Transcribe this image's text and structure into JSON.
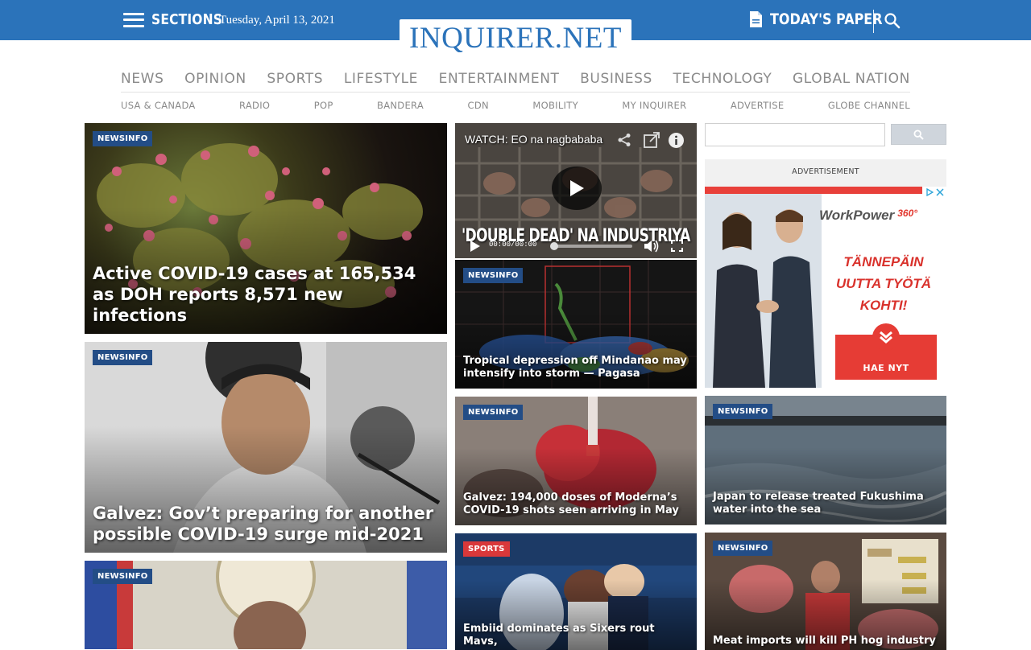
{
  "header": {
    "sections_label": "SECTIONS",
    "date": "Tuesday, April 13, 2021",
    "logo": "INQUIRER.NET",
    "todays_paper_label": "TODAY'S PAPER",
    "brand_color": "#2b73ba"
  },
  "main_nav": [
    "NEWS",
    "OPINION",
    "SPORTS",
    "LIFESTYLE",
    "ENTERTAINMENT",
    "BUSINESS",
    "TECHNOLOGY",
    "GLOBAL NATION"
  ],
  "sub_nav": [
    "USA & CANADA",
    "RADIO",
    "POP",
    "BANDERA",
    "CDN",
    "MOBILITY",
    "MY INQUIRER",
    "ADVERTISE",
    "GLOBE CHANNEL"
  ],
  "stories": [
    {
      "category": "NEWSINFO",
      "headline": "Active COVID-19 cases at 165,534 as DOH reports 8,571 new infections"
    },
    {
      "category": "NEWSINFO",
      "headline": "Galvez: Gov’t preparing for another possible COVID-19 surge mid-2021"
    },
    {
      "category": "NEWSINFO",
      "headline": ""
    },
    {
      "category": "NEWSINFO",
      "headline": "Tropical depression off Mindanao may intensify into storm — Pagasa"
    },
    {
      "category": "NEWSINFO",
      "headline": "Galvez: 194,000 doses of Moderna’s COVID-19 shots seen arriving in May"
    },
    {
      "category": "SPORTS",
      "headline": "Embiid dominates as Sixers rout Mavs,"
    },
    {
      "category": "NEWSINFO",
      "headline": "Japan to release treated Fukushima water into the sea"
    },
    {
      "category": "NEWSINFO",
      "headline": "Meat imports will kill PH hog industry"
    }
  ],
  "video": {
    "title": "WATCH: EO na nagbababa",
    "banner": "'DOUBLE DEAD' NA INDUSTRIYA",
    "time": "00:00/00:00"
  },
  "ad": {
    "label": "ADVERTISEMENT",
    "brand": "WorkPower",
    "brand_suffix": "360°",
    "tagline_1": "TÄNNEPÄIN",
    "tagline_2": "UUTTA TYÖTÄ",
    "tagline_3": "KOHTI!",
    "cta": "HAE NYT"
  }
}
